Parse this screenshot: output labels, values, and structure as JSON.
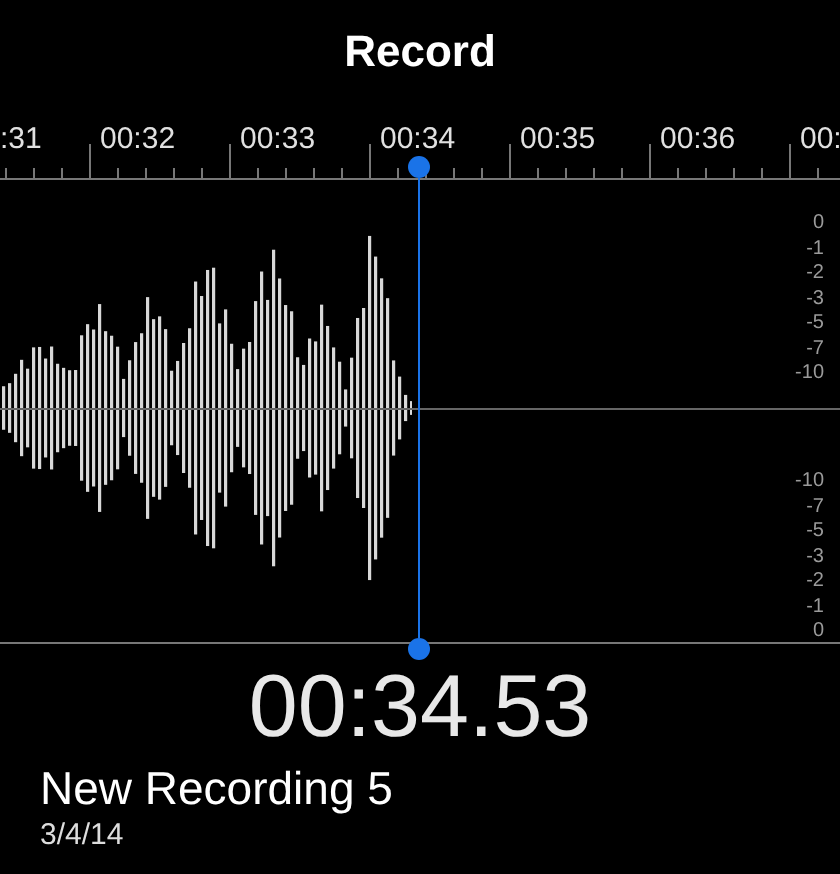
{
  "title": "Record",
  "timeline": {
    "labels": [
      ":31",
      "00:32",
      "00:33",
      "00:34",
      "00:35",
      "00:36",
      "00:"
    ]
  },
  "db_scale": {
    "upper": [
      "0",
      "-1",
      "-2",
      "-3",
      "-5",
      "-7",
      "-10"
    ],
    "lower": [
      "-10",
      "-7",
      "-5",
      "-3",
      "-2",
      "-1",
      "0"
    ]
  },
  "elapsed": "00:34.53",
  "recording": {
    "name": "New Recording 5",
    "date": "3/4/14"
  }
}
